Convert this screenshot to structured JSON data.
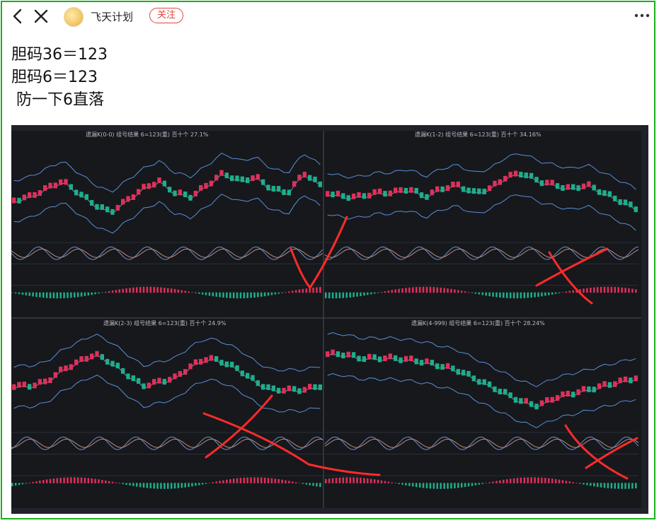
{
  "header": {
    "account_name": "飞天计划",
    "follow_label": "关注",
    "icons": [
      "back-arrow-icon",
      "close-icon",
      "more-dots-icon"
    ]
  },
  "post": {
    "lines": [
      "胆码36＝123",
      "胆码6＝123",
      " 防一下6直落"
    ]
  },
  "screenshot": {
    "panels": [
      {
        "title": "遗漏K(0-0)  组号结果  6=123(重)  百十个  27.1%"
      },
      {
        "title": "遗漏K(1-2)  组号结果  6=123(重)  百十个  34.16%"
      },
      {
        "title": "遗漏K(2-3)  组号结果  6=123(重)  百十个  24.9%"
      },
      {
        "title": "遗漏K(4-999)  组号结果  6=123(重)  百十个  28.24%"
      }
    ]
  },
  "colors": {
    "frame": "#1ab01a",
    "follow": "#e0453c",
    "up_candle": "#e0305a",
    "down_candle": "#1fae8a",
    "band": "#5b8fd6",
    "annotation": "#ff2b2b"
  }
}
